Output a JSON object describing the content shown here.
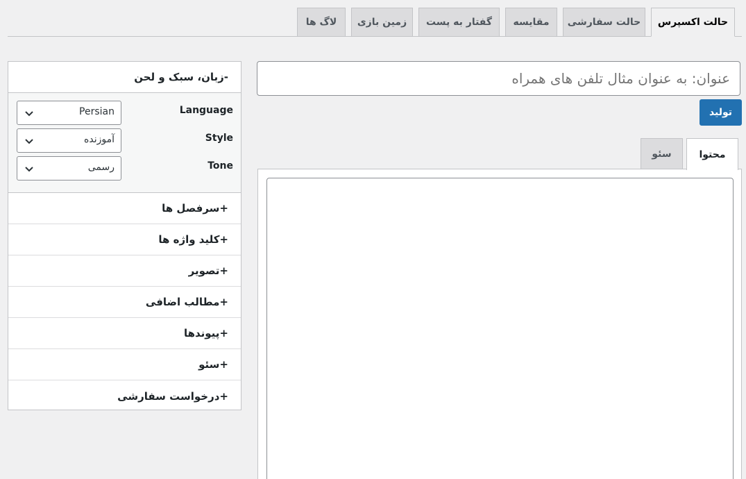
{
  "tabs": [
    {
      "label": "حالت اکسپرس",
      "active": true
    },
    {
      "label": "حالت سفارشی",
      "active": false
    },
    {
      "label": "مقایسه",
      "active": false
    },
    {
      "label": "گفتار به پست",
      "active": false
    },
    {
      "label": "زمین بازی",
      "active": false
    },
    {
      "label": "لاگ ها",
      "active": false
    }
  ],
  "settings_panel": {
    "header": "-زبان، سبک و لحن",
    "language_label": "Language",
    "language_value": "Persian",
    "style_label": "Style",
    "style_value": "آموزنده",
    "tone_label": "Tone",
    "tone_value": "رسمی"
  },
  "sections": [
    "+سرفصل ها",
    "+کلید واژه ها",
    "+تصویر",
    "+مطالب اضافی",
    "+پیوندها",
    "+سئو",
    "+درخواست سفارشی"
  ],
  "main": {
    "title_placeholder": "عنوان: به عنوان مثال تلفن های همراه",
    "generate_label": "تولید",
    "content_tab": "محتوا",
    "seo_tab": "سئو"
  },
  "colors": {
    "primary": "#2271b1",
    "background": "#f0f0f1",
    "border": "#c3c4c7"
  }
}
